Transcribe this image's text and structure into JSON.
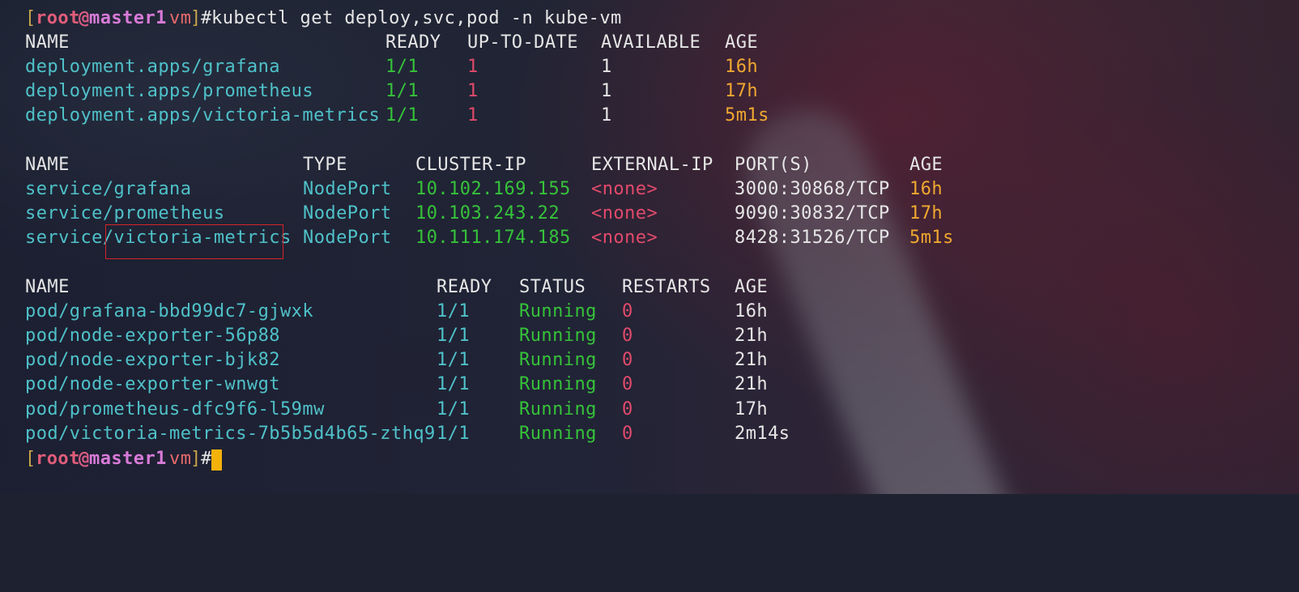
{
  "prompt": {
    "open_bracket": "[",
    "user": "root",
    "at": "@",
    "host": "master1",
    "space": " ",
    "dir": "vm",
    "close_bracket": "]",
    "hash": "#"
  },
  "command": "kubectl get deploy,svc,pod -n kube-vm",
  "deployments": {
    "headers": [
      "NAME",
      "READY",
      "UP-TO-DATE",
      "AVAILABLE",
      "AGE"
    ],
    "rows": [
      {
        "name": "deployment.apps/grafana",
        "ready": "1/1",
        "up_to_date": "1",
        "available": "1",
        "age": "16h"
      },
      {
        "name": "deployment.apps/prometheus",
        "ready": "1/1",
        "up_to_date": "1",
        "available": "1",
        "age": "17h"
      },
      {
        "name": "deployment.apps/victoria-metrics",
        "ready": "1/1",
        "up_to_date": "1",
        "available": "1",
        "age": "5m1s"
      }
    ]
  },
  "services": {
    "headers": [
      "NAME",
      "TYPE",
      "CLUSTER-IP",
      "EXTERNAL-IP",
      "PORT(S)",
      "AGE"
    ],
    "rows": [
      {
        "name": "service/grafana",
        "type": "NodePort",
        "cluster_ip": "10.102.169.155",
        "external_ip": "<none>",
        "ports": "3000:30868/TCP",
        "age": "16h"
      },
      {
        "name": "service/prometheus",
        "type": "NodePort",
        "cluster_ip": "10.103.243.22",
        "external_ip": "<none>",
        "ports": "9090:30832/TCP",
        "age": "17h"
      },
      {
        "name": "service/victoria-metrics",
        "type": "NodePort",
        "cluster_ip": "10.111.174.185",
        "external_ip": "<none>",
        "ports": "8428:31526/TCP",
        "age": "5m1s"
      }
    ]
  },
  "pods": {
    "headers": [
      "NAME",
      "READY",
      "STATUS",
      "RESTARTS",
      "AGE"
    ],
    "rows": [
      {
        "name": "pod/grafana-bbd99dc7-gjwxk",
        "ready": "1/1",
        "status": "Running",
        "restarts": "0",
        "age": "16h"
      },
      {
        "name": "pod/node-exporter-56p88",
        "ready": "1/1",
        "status": "Running",
        "restarts": "0",
        "age": "21h"
      },
      {
        "name": "pod/node-exporter-bjk82",
        "ready": "1/1",
        "status": "Running",
        "restarts": "0",
        "age": "21h"
      },
      {
        "name": "pod/node-exporter-wnwgt",
        "ready": "1/1",
        "status": "Running",
        "restarts": "0",
        "age": "21h"
      },
      {
        "name": "pod/prometheus-dfc9f6-l59mw",
        "ready": "1/1",
        "status": "Running",
        "restarts": "0",
        "age": "17h"
      },
      {
        "name": "pod/victoria-metrics-7b5b5d4b65-zthq9",
        "ready": "1/1",
        "status": "Running",
        "restarts": "0",
        "age": "2m14s"
      }
    ]
  },
  "colors": {
    "name": "#4fc1c9",
    "ready_green": "#36c23a",
    "red": "#e24a6b",
    "age_orange": "#f0a830",
    "cursor": "#f2b20a",
    "highlight_box": "#d8232a"
  }
}
